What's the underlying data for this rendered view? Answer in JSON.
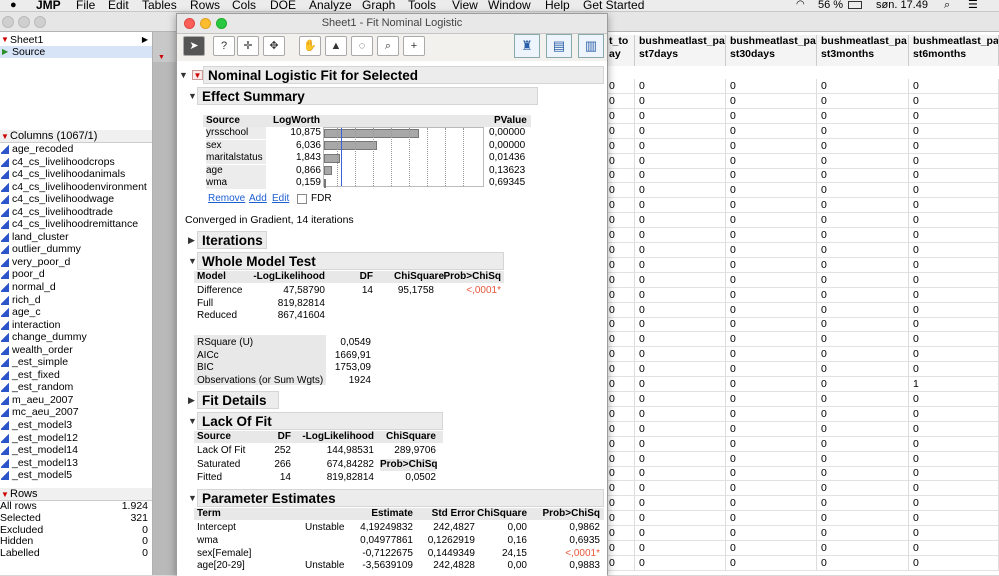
{
  "menubar": {
    "apple": "",
    "items": [
      "JMP",
      "File",
      "Edit",
      "Tables",
      "Rows",
      "Cols",
      "DOE",
      "Analyze",
      "Graph",
      "Tools",
      "View",
      "Window",
      "Help",
      "Get Started"
    ],
    "battery": "56 %",
    "clock": "søn. 17.49"
  },
  "left": {
    "table_name": "Sheet1",
    "source": "Source",
    "columns_header": "Columns (1067/1)",
    "columns": [
      "age_recoded",
      "c4_cs_livelihoodcrops",
      "c4_cs_livelihoodanimals",
      "c4_cs_livelihoodenvironment",
      "c4_cs_livelihoodwage",
      "c4_cs_livelihoodtrade",
      "c4_cs_livelihoodremittance",
      "land_cluster",
      "outlier_dummy",
      "very_poor_d",
      "poor_d",
      "normal_d",
      "rich_d",
      "age_c",
      "interaction",
      "change_dummy",
      "wealth_order",
      "_est_simple",
      "_est_fixed",
      "_est_random",
      "m_aeu_2007",
      "mc_aeu_2007",
      "_est_model3",
      "_est_model12",
      "_est_model14",
      "_est_model13",
      "_est_model5"
    ],
    "rows_header": "Rows",
    "rows": [
      {
        "label": "All rows",
        "value": "1.924"
      },
      {
        "label": "Selected",
        "value": "321"
      },
      {
        "label": "Excluded",
        "value": "0"
      },
      {
        "label": "Hidden",
        "value": "0"
      },
      {
        "label": "Labelled",
        "value": "0"
      }
    ]
  },
  "grid": {
    "headers": [
      "t_to\nay",
      "bushmeatlast_pa\nst7days",
      "bushmeatlast_pa\nst30days",
      "bushmeatlast_pa\nst3months",
      "bushmeatlast_pa\nst6months"
    ],
    "row_values": [
      "0",
      "0",
      "0",
      "0",
      "0",
      "0",
      "0",
      "0",
      "0",
      "0",
      "0",
      "0",
      "0",
      "0",
      "0",
      "0",
      "0",
      "0",
      "0",
      "0",
      "0",
      "0",
      "0",
      "0",
      "0",
      "0",
      "0",
      "0",
      "0",
      "0",
      "0",
      "0",
      "0"
    ],
    "special_col4_row": {
      "index": 20,
      "value": "1"
    }
  },
  "report": {
    "window_title": "Sheet1 - Fit Nominal Logistic",
    "main_title": "Nominal Logistic Fit for Selected",
    "effect_summary": {
      "title": "Effect Summary",
      "headers": [
        "Source",
        "LogWorth",
        "PValue"
      ],
      "rows": [
        {
          "source": "yrsschool",
          "logworth": "10,875",
          "pvalue": "0,00000",
          "lw": 10.875
        },
        {
          "source": "sex",
          "logworth": "6,036",
          "pvalue": "0,00000",
          "lw": 6.036
        },
        {
          "source": "maritalstatus",
          "logworth": "1,843",
          "pvalue": "0,01436",
          "lw": 1.843
        },
        {
          "source": "age",
          "logworth": "0,866",
          "pvalue": "0,13623",
          "lw": 0.866
        },
        {
          "source": "wma",
          "logworth": "0,159",
          "pvalue": "0,69345",
          "lw": 0.159
        }
      ],
      "remove": "Remove",
      "add": "Add",
      "edit": "Edit",
      "fdr": "FDR"
    },
    "converged": "Converged in Gradient, 14 iterations",
    "iterations": "Iterations",
    "whole_model": {
      "title": "Whole Model Test",
      "headers": [
        "Model",
        "-LogLikelihood",
        "DF",
        "ChiSquare",
        "Prob>ChiSq"
      ],
      "rows": [
        [
          "Difference",
          "47,58790",
          "14",
          "95,1758",
          "<,0001*"
        ],
        [
          "Full",
          "819,82814",
          "",
          "",
          ""
        ],
        [
          "Reduced",
          "867,41604",
          "",
          "",
          ""
        ]
      ],
      "stats": [
        [
          "RSquare (U)",
          "0,0549"
        ],
        [
          "AICc",
          "1669,91"
        ],
        [
          "BIC",
          "1753,09"
        ],
        [
          "Observations (or Sum Wgts)",
          "1924"
        ]
      ]
    },
    "fit_details": "Fit Details",
    "lack_of_fit": {
      "title": "Lack Of Fit",
      "headers": [
        "Source",
        "DF",
        "-LogLikelihood",
        "ChiSquare"
      ],
      "rows": [
        [
          "Lack Of Fit",
          "252",
          "144,98531",
          "289,9706"
        ],
        [
          "Saturated",
          "266",
          "674,84282",
          "Prob>ChiSq"
        ],
        [
          "Fitted",
          "14",
          "819,82814",
          "0,0502"
        ]
      ]
    },
    "param": {
      "title": "Parameter Estimates",
      "headers": [
        "Term",
        "",
        "Estimate",
        "Std Error",
        "ChiSquare",
        "Prob>ChiSq"
      ],
      "rows": [
        [
          "Intercept",
          "Unstable",
          "4,19249832",
          "242,4827",
          "0,00",
          "0,9862"
        ],
        [
          "wma",
          "",
          "0,04977861",
          "0,1262919",
          "0,16",
          "0,6935"
        ],
        [
          "sex[Female]",
          "",
          "-0,7122675",
          "0,1449349",
          "24,15",
          "<,0001*"
        ],
        [
          "age[20-29]",
          "Unstable",
          "-3,5639109",
          "242,4828",
          "0,00",
          "0,9883"
        ]
      ]
    }
  }
}
